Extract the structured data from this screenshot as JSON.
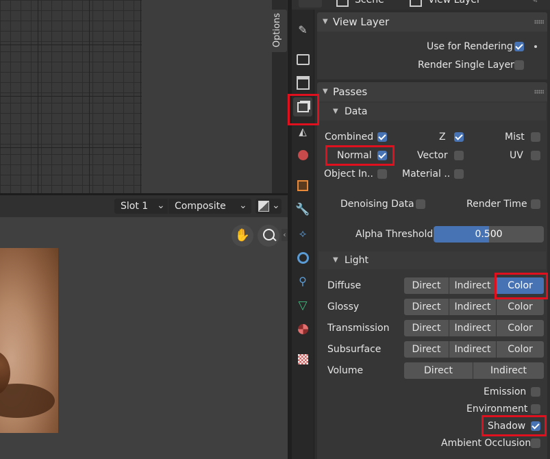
{
  "header": {
    "scene_label": "Scene",
    "view_layer_label": "View Layer"
  },
  "image_editor": {
    "slot": "Slot 1",
    "composite": "Composite",
    "options_tab": "Options"
  },
  "panels": {
    "view_layer": {
      "title": "View Layer",
      "use_for_rendering": "Use for Rendering",
      "render_single_layer": "Render Single Layer"
    },
    "passes": {
      "title": "Passes",
      "data": {
        "title": "Data",
        "combined": "Combined",
        "z": "Z",
        "mist": "Mist",
        "normal": "Normal",
        "vector": "Vector",
        "uv": "UV",
        "object_index": "Object In..",
        "material_index": "Material ..",
        "denoising_data": "Denoising Data",
        "render_time": "Render Time",
        "alpha_threshold_label": "Alpha Threshold",
        "alpha_threshold_value": "0.500",
        "alpha_threshold_fraction": 0.5
      },
      "light": {
        "title": "Light",
        "rows": [
          {
            "name": "Diffuse",
            "direct": "Direct",
            "indirect": "Indirect",
            "color": "Color"
          },
          {
            "name": "Glossy",
            "direct": "Direct",
            "indirect": "Indirect",
            "color": "Color"
          },
          {
            "name": "Transmission",
            "direct": "Direct",
            "indirect": "Indirect",
            "color": "Color"
          },
          {
            "name": "Subsurface",
            "direct": "Direct",
            "indirect": "Indirect",
            "color": "Color"
          }
        ],
        "volume": {
          "name": "Volume",
          "direct": "Direct",
          "indirect": "Indirect"
        },
        "emission": "Emission",
        "environment": "Environment",
        "shadow": "Shadow",
        "ambient_occlusion": "Ambient Occlusion"
      }
    }
  },
  "colors": {
    "accent": "#4772b3",
    "highlight": "#e0101e"
  }
}
